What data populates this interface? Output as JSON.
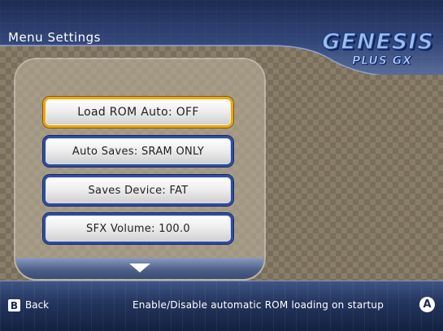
{
  "header": {
    "title": "Menu Settings",
    "logo_line1": "GENESIS",
    "logo_line2": "PLUS GX"
  },
  "menu": {
    "options": [
      {
        "label": "Load ROM Auto: OFF",
        "selected": true
      },
      {
        "label": "Auto Saves: SRAM ONLY",
        "selected": false
      },
      {
        "label": "Saves Device: FAT",
        "selected": false
      },
      {
        "label": "SFX Volume: 100.0",
        "selected": false
      }
    ],
    "more_icon": "chevron-down-icon"
  },
  "footer": {
    "back_button_glyph": "B",
    "back_label": "Back",
    "hint": "Enable/Disable automatic ROM loading on startup",
    "confirm_button_glyph": "A"
  },
  "colors": {
    "selected_border": "#e4a81a",
    "option_border": "#2e4ca0",
    "bar_blue": "#24365f"
  }
}
